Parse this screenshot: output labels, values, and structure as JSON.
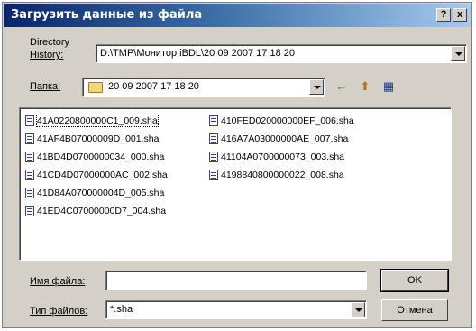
{
  "window": {
    "title": "Загрузить данные из файла",
    "help_label": "?",
    "close_label": "x"
  },
  "directory_history": {
    "label_line1": "Directory",
    "label_line2": "History:",
    "value": "D:\\TMP\\Монитор iBDL\\20 09 2007 17 18 20"
  },
  "folder": {
    "label": "Папка:",
    "value": "20 09 2007 17 18 20",
    "back_icon": "←",
    "up_icon": "⬆",
    "view_icon": "▦"
  },
  "files": {
    "column1": [
      "41A0220800000C1_009.sha",
      "41AF4B07000009D_001.sha",
      "41BD4D0700000034_000.sha",
      "41CD4D07000000AC_002.sha",
      "41D84A070000004D_005.sha",
      "41ED4C07000000D7_004.sha"
    ],
    "column2": [
      "410FED020000000EF_006.sha",
      "416A7A03000000AE_007.sha",
      "41104A0700000073_003.sha",
      "4198840800000022_008.sha"
    ]
  },
  "filename": {
    "label": "Имя файла:",
    "value": ""
  },
  "filetype": {
    "label": "Тип файлов:",
    "value": "*.sha"
  },
  "buttons": {
    "ok": "OK",
    "cancel": "Отмена"
  }
}
